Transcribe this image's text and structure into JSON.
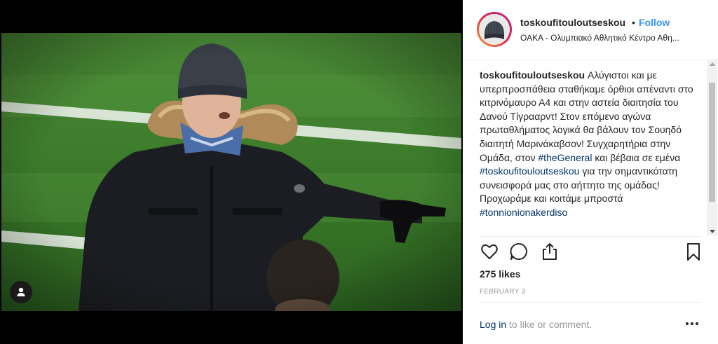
{
  "post": {
    "username": "toskoufitouloutseskou",
    "dot": "•",
    "follow_label": "Follow",
    "location": "ΟΑΚΑ - Ολυμπιακό Αθλητικό Κέντρο Αθη...",
    "caption": {
      "user": "toskoufitouloutseskou",
      "part1": "Αλύγιστοι και με υπερπροσπάθεια σταθήκαμε όρθιοι απέναντι στο κιτρινόμαυρο Α4 και στην αστεία διαιτησία του Δανού Τίγρααρντ! Στον επόμενο αγώνα πρωταθλήματος λογικά θα βάλουν τον Σουηδό διαιτητή Μαρινάκαβσον! Συγχαρητήρια στην Ομάδα, στον ",
      "tag1": "#theGeneral",
      "part2": " και βέβαια σε εμένα ",
      "tag2": "#toskoufitouloutseskou",
      "part3": " για την σημαντικότατη συνεισφορά μας στο αήττητο της ομάδας! Προχωράμε και κοιτάμε μπροστά ",
      "tag3": "#tonnionionakerdiso"
    },
    "likes": "275 likes",
    "date": "FEBRUARY 3",
    "login_link": "Log in",
    "login_rest": " to like or comment."
  },
  "icons": {
    "like": "heart-icon",
    "comment": "comment-icon",
    "share": "share-icon",
    "save": "bookmark-icon",
    "more": "more-dots-icon",
    "user_tag": "user-icon"
  }
}
